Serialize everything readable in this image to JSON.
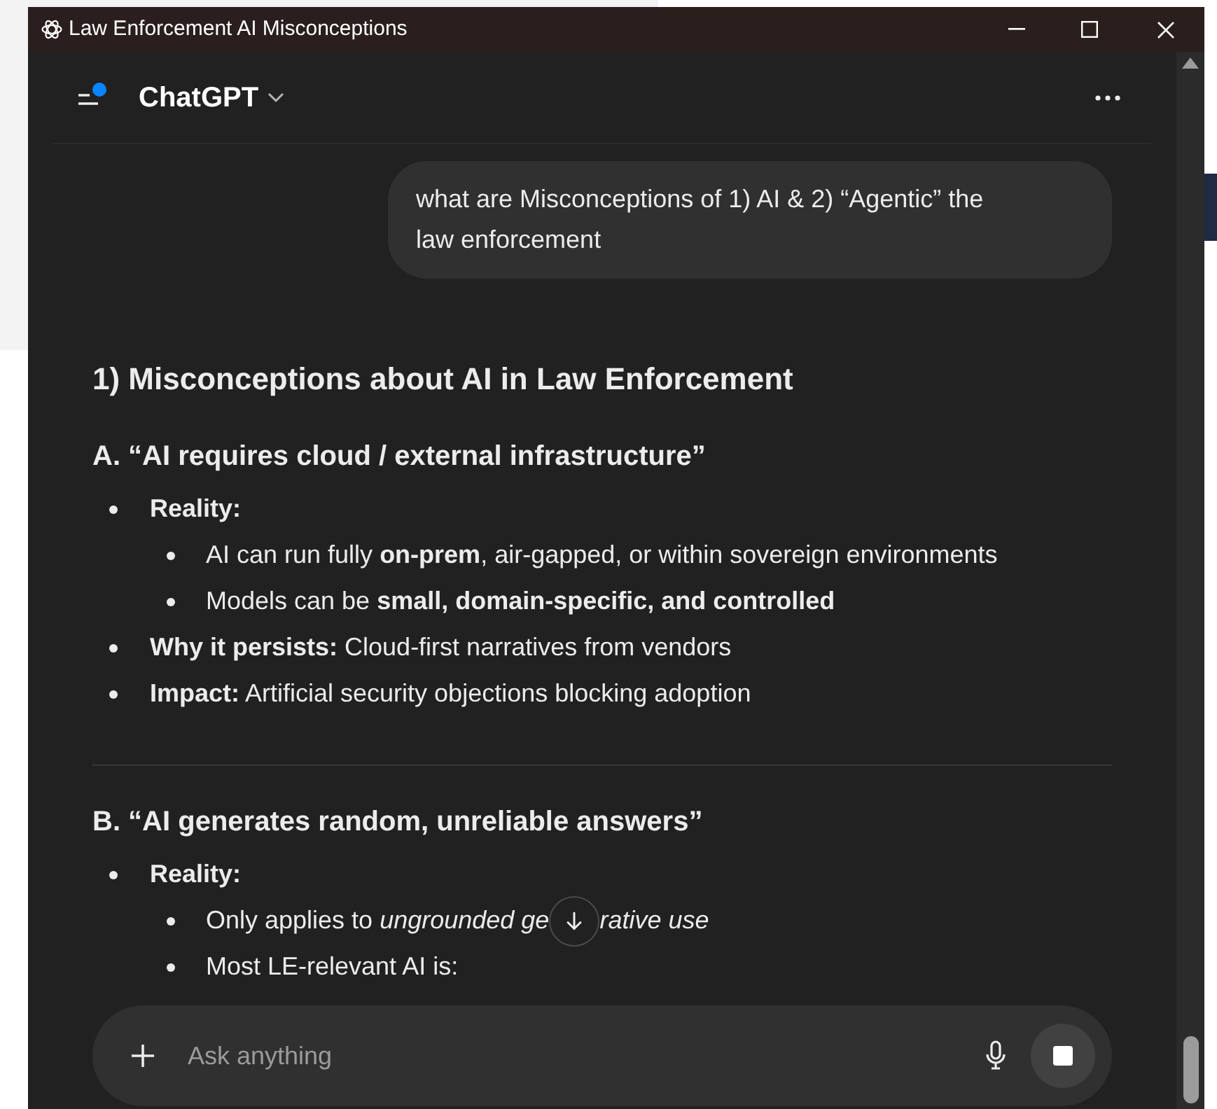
{
  "window": {
    "title": "Law Enforcement AI Misconceptions"
  },
  "header": {
    "title": "ChatGPT",
    "sidebar_notification": true
  },
  "user_message": "what are Misconceptions of 1) AI & 2) “Agentic”  the law enforcement",
  "blocks": [
    {
      "kind": "h2",
      "text": "1) Misconceptions about AI in Law Enforcement"
    },
    {
      "kind": "h3",
      "text": "A. “AI requires cloud / external infrastructure”"
    },
    {
      "kind": "list",
      "items": [
        {
          "text": "**Reality:**",
          "children": [
            {
              "text": "AI can run fully **on-prem**, air-gapped, or within sovereign environments"
            },
            {
              "text": "Models can be **small, domain-specific, and controlled**"
            }
          ]
        },
        {
          "text": "**Why it persists:** Cloud-first narratives from vendors"
        },
        {
          "text": "**Impact:** Artificial security objections blocking adoption"
        }
      ]
    },
    {
      "kind": "divider"
    },
    {
      "kind": "h3",
      "text": "B. “AI generates random, unreliable answers”"
    },
    {
      "kind": "list",
      "items": [
        {
          "text": "**Reality:**",
          "children": [
            {
              "text": "Only applies to *ungrounded ge*",
              "after_scroll_button": "*rative use*"
            },
            {
              "text": "Most LE-relevant AI is:"
            }
          ]
        }
      ]
    }
  ],
  "composer": {
    "placeholder": "Ask anything"
  }
}
